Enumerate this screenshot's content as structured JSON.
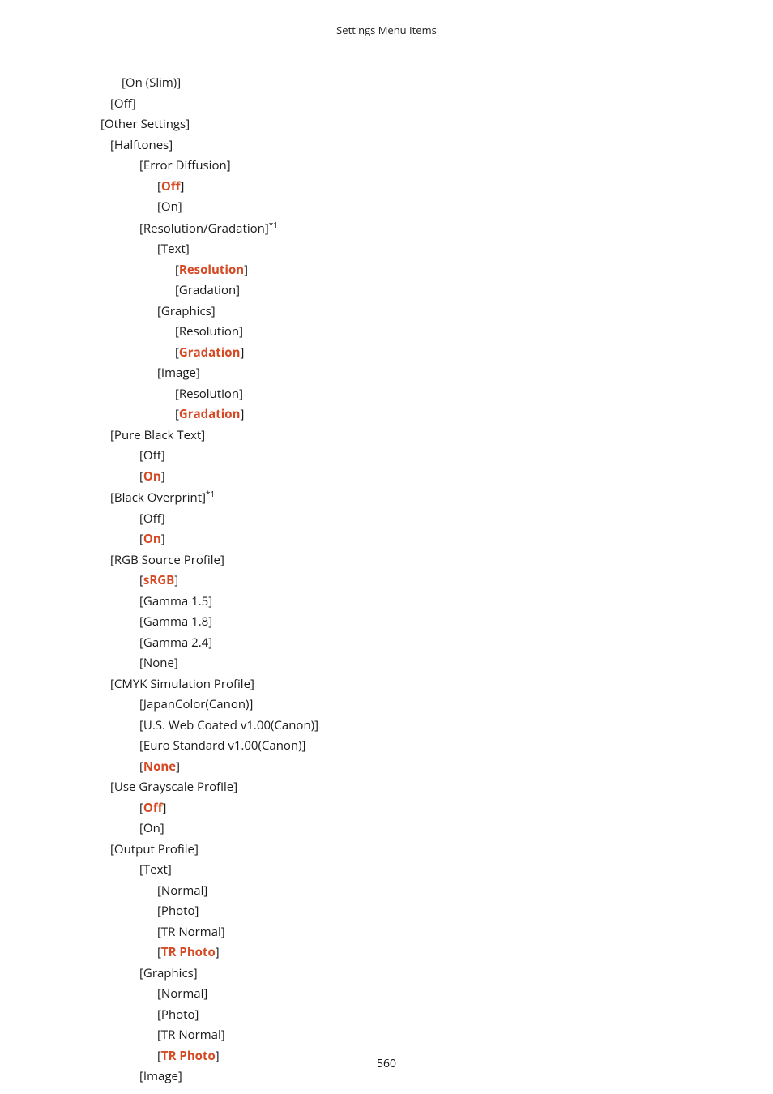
{
  "header": "Settings Menu Items",
  "page_number": "560",
  "items": [
    {
      "indent": 2,
      "pre": "[",
      "text": "On (Slim)",
      "post": "]",
      "hl": false
    },
    {
      "indent": 1,
      "pre": "[",
      "text": "Off",
      "post": "]",
      "hl": false
    },
    {
      "indent": 0,
      "pre": "[",
      "text": "Other Settings",
      "post": "]",
      "hl": false
    },
    {
      "indent": 1,
      "pre": "[",
      "text": "Halftones",
      "post": "]",
      "hl": false
    },
    {
      "indent": 3,
      "pre": "[",
      "text": "Error Diffusion",
      "post": "]",
      "hl": false
    },
    {
      "indent": 4,
      "pre": "[",
      "text": "Off",
      "post": "]",
      "hl": true
    },
    {
      "indent": 4,
      "pre": "[",
      "text": "On",
      "post": "]",
      "hl": false
    },
    {
      "indent": 3,
      "pre": "[",
      "text": "Resolution/Gradation",
      "post": "]",
      "hl": false,
      "sup": "*1"
    },
    {
      "indent": 4,
      "pre": "[",
      "text": "Text",
      "post": "]",
      "hl": false
    },
    {
      "indent": 5,
      "pre": "[",
      "text": "Resolution",
      "post": "]",
      "hl": true
    },
    {
      "indent": 5,
      "pre": "[",
      "text": "Gradation",
      "post": "]",
      "hl": false
    },
    {
      "indent": 4,
      "pre": "[",
      "text": "Graphics",
      "post": "]",
      "hl": false
    },
    {
      "indent": 5,
      "pre": "[",
      "text": "Resolution",
      "post": "]",
      "hl": false
    },
    {
      "indent": 5,
      "pre": "[",
      "text": "Gradation",
      "post": "]",
      "hl": true
    },
    {
      "indent": 4,
      "pre": "[",
      "text": "Image",
      "post": "]",
      "hl": false
    },
    {
      "indent": 5,
      "pre": "[",
      "text": "Resolution",
      "post": "]",
      "hl": false
    },
    {
      "indent": 5,
      "pre": "[",
      "text": "Gradation",
      "post": "]",
      "hl": true
    },
    {
      "indent": 1,
      "pre": "[",
      "text": "Pure Black Text",
      "post": "]",
      "hl": false
    },
    {
      "indent": 3,
      "pre": "[",
      "text": "Off",
      "post": "]",
      "hl": false
    },
    {
      "indent": 3,
      "pre": "[",
      "text": "On",
      "post": "]",
      "hl": true
    },
    {
      "indent": 1,
      "pre": "[",
      "text": "Black Overprint",
      "post": "]",
      "hl": false,
      "sup": "*1"
    },
    {
      "indent": 3,
      "pre": "[",
      "text": "Off",
      "post": "]",
      "hl": false
    },
    {
      "indent": 3,
      "pre": "[",
      "text": "On",
      "post": "]",
      "hl": true
    },
    {
      "indent": 1,
      "pre": "[",
      "text": "RGB Source Profile",
      "post": "]",
      "hl": false
    },
    {
      "indent": 3,
      "pre": "[",
      "text": "sRGB",
      "post": "]",
      "hl": true
    },
    {
      "indent": 3,
      "pre": "[",
      "text": "Gamma 1.5",
      "post": "]",
      "hl": false
    },
    {
      "indent": 3,
      "pre": "[",
      "text": "Gamma 1.8",
      "post": "]",
      "hl": false
    },
    {
      "indent": 3,
      "pre": "[",
      "text": "Gamma 2.4",
      "post": "]",
      "hl": false
    },
    {
      "indent": 3,
      "pre": "[",
      "text": "None",
      "post": "]",
      "hl": false
    },
    {
      "indent": 1,
      "pre": "[",
      "text": "CMYK Simulation Profile",
      "post": "]",
      "hl": false
    },
    {
      "indent": 3,
      "pre": "[",
      "text": "JapanColor(Canon)",
      "post": "]",
      "hl": false
    },
    {
      "indent": 3,
      "pre": "[",
      "text": "U.S. Web Coated v1.00(Canon)",
      "post": "]",
      "hl": false
    },
    {
      "indent": 3,
      "pre": "[",
      "text": "Euro Standard v1.00(Canon)",
      "post": "]",
      "hl": false
    },
    {
      "indent": 3,
      "pre": "[",
      "text": "None",
      "post": "]",
      "hl": true
    },
    {
      "indent": 1,
      "pre": "[",
      "text": "Use Grayscale Profile",
      "post": "]",
      "hl": false
    },
    {
      "indent": 3,
      "pre": "[",
      "text": "Off",
      "post": "]",
      "hl": true
    },
    {
      "indent": 3,
      "pre": "[",
      "text": "On",
      "post": "]",
      "hl": false
    },
    {
      "indent": 1,
      "pre": "[",
      "text": "Output Profile",
      "post": "]",
      "hl": false
    },
    {
      "indent": 3,
      "pre": "[",
      "text": "Text",
      "post": "]",
      "hl": false
    },
    {
      "indent": 4,
      "pre": "[",
      "text": "Normal",
      "post": "]",
      "hl": false
    },
    {
      "indent": 4,
      "pre": "[",
      "text": "Photo",
      "post": "]",
      "hl": false
    },
    {
      "indent": 4,
      "pre": "[",
      "text": "TR Normal",
      "post": "]",
      "hl": false
    },
    {
      "indent": 4,
      "pre": "[",
      "text": "TR Photo",
      "post": "]",
      "hl": true
    },
    {
      "indent": 3,
      "pre": "[",
      "text": "Graphics",
      "post": "]",
      "hl": false
    },
    {
      "indent": 4,
      "pre": "[",
      "text": "Normal",
      "post": "]",
      "hl": false
    },
    {
      "indent": 4,
      "pre": "[",
      "text": "Photo",
      "post": "]",
      "hl": false
    },
    {
      "indent": 4,
      "pre": "[",
      "text": "TR Normal",
      "post": "]",
      "hl": false
    },
    {
      "indent": 4,
      "pre": "[",
      "text": "TR Photo",
      "post": "]",
      "hl": true
    },
    {
      "indent": 3,
      "pre": "[",
      "text": "Image",
      "post": "]",
      "hl": false
    }
  ]
}
